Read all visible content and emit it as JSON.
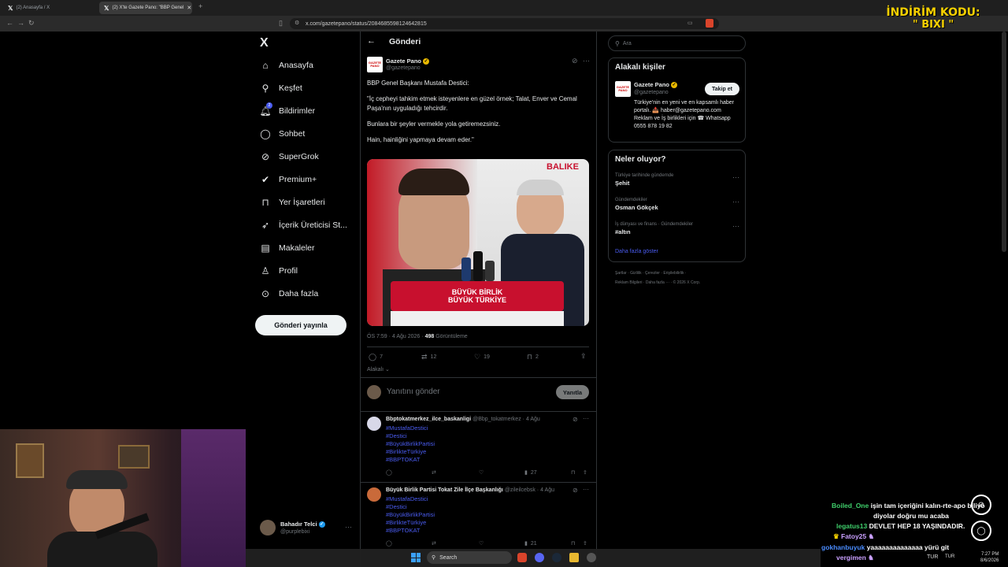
{
  "browser": {
    "tabs": [
      {
        "label": "(2) Anasayfa / X"
      },
      {
        "label": "(2) X'te Gazete Pano: \"BBP Genel",
        "active": true
      }
    ],
    "url": "x.com/gazetepano/status/2084685598124642815"
  },
  "overlay": {
    "promo_line1": "İNDİRİM KODU:",
    "promo_line2": "\" BIXI \""
  },
  "sidebar": {
    "logo": "X",
    "items": [
      {
        "label": "Anasayfa",
        "icon": "home-icon"
      },
      {
        "label": "Keşfet",
        "icon": "search-icon"
      },
      {
        "label": "Bildirimler",
        "icon": "bell-icon",
        "badge": "2"
      },
      {
        "label": "Sohbet",
        "icon": "chat-icon"
      },
      {
        "label": "SuperGrok",
        "icon": "grok-icon"
      },
      {
        "label": "Premium+",
        "icon": "premium-icon"
      },
      {
        "label": "Yer İşaretleri",
        "icon": "bookmark-icon"
      },
      {
        "label": "İçerik Üreticisi St...",
        "icon": "rocket-icon"
      },
      {
        "label": "Makaleler",
        "icon": "article-icon"
      },
      {
        "label": "Profil",
        "icon": "person-icon"
      },
      {
        "label": "Daha fazla",
        "icon": "more-circle-icon"
      }
    ],
    "post_button": "Gönderi yayınla",
    "account": {
      "name": "Bahadır Telci",
      "handle": "@purplebixi"
    }
  },
  "main": {
    "title": "Gönderi",
    "post": {
      "author": "Gazete Pano",
      "handle": "@gazetepano",
      "line1": "BBP Genel Başkanı Mustafa Destici:",
      "line2": "\"İç cepheyi tahkim etmek isteyenlere en güzel örnek; Talat, Enver ve Cemal Paşa'nın uyguladığı tehcirdir.",
      "line3": "Bunlara bir şeyler vermekle yola getiremezsiniz.",
      "line4": "Hain, hainliğini yapmaya devam eder.\"",
      "image_banner1": "BÜYÜK BİRLİK",
      "image_banner2": "BÜYÜK TÜRKİYE",
      "image_corner": "BALIKE",
      "time": "ÖS 7:59 · 4 Ağu 2026 ·",
      "views": "498",
      "views_label": "Görüntüleme",
      "replies": "7",
      "reposts": "12",
      "likes": "19",
      "bookmarks": "2",
      "relevant": "Alakalı"
    },
    "reply_box": {
      "placeholder": "Yanıtını gönder",
      "button": "Yanıtla"
    },
    "replies": [
      {
        "author": "Bbptokatmerkez_ilce_baskanligi",
        "handle": "@Bbp_tokatmerkez",
        "date": "· 4 Ağu",
        "tags": [
          "#MustafaDestici",
          "#Destici",
          "#BüyükBirlikPartisi",
          "#BirlikteTürkiye",
          "#BBPTOKAT"
        ],
        "views": "27"
      },
      {
        "author": "Büyük Birlik Partisi Tokat Zile İlçe Başkanlığı",
        "handle": "@zileilcebsk",
        "date": "· 4 Ağu",
        "tags": [
          "#MustafaDestici",
          "#Destici",
          "#BüyükBirlikPartisi",
          "#BirlikteTürkiye",
          "#BBPTOKAT"
        ],
        "views": "21"
      }
    ]
  },
  "right": {
    "search_placeholder": "Ara",
    "people_title": "Alakalı kişiler",
    "person": {
      "name": "Gazete Pano",
      "handle": "@gazetepano",
      "follow": "Takip et",
      "bio": "Türkiye'nin en yeni ve en kapsamlı haber portalı. 📥 haber@gazetepano.com Reklam ve İş birlikleri için ☎ Whatsapp 0555 878 19 82"
    },
    "trends_title": "Neler oluyor?",
    "trends": [
      {
        "context": "Türkiye tarihinde gündemde",
        "name": "Şehit"
      },
      {
        "context": "Gündemdekiler",
        "name": "Osman Gökçek"
      },
      {
        "context": "İş dünyası ve finans · Gündemdekiler",
        "name": "#altın"
      }
    ],
    "show_more": "Daha fazla göster",
    "footer1": "Şartlar · Gizlilik · Çerezler · Erişilebilirlik ·",
    "footer2": "Reklam Bilgileri · Daha fazla ··· · © 2026 X Corp."
  },
  "chat": [
    {
      "user": "Boiled_One",
      "color": "#3fcf6b",
      "msg": "işin tam içeriğini kalın-rte-apo biliyo"
    },
    {
      "user": "",
      "color": "#ffffff",
      "msg": "diyolar doğru mu acaba"
    },
    {
      "user": "legatus13",
      "color": "#3fcf6b",
      "msg": "DEVLET HEP 18 YAŞINDADIR."
    },
    {
      "user": "Fatoy25",
      "color": "#c9a0ff",
      "msg": ""
    },
    {
      "user": "gokhanbuyuk",
      "color": "#4a8cff",
      "msg": "yaaaaaaaaaaaaaa yürü git"
    },
    {
      "user": "vergimen",
      "color": "#c9a0ff",
      "msg": ""
    }
  ],
  "taskbar": {
    "search": "Search",
    "lang": "TUR",
    "time": "7:27 PM",
    "date": "8/6/2026"
  }
}
